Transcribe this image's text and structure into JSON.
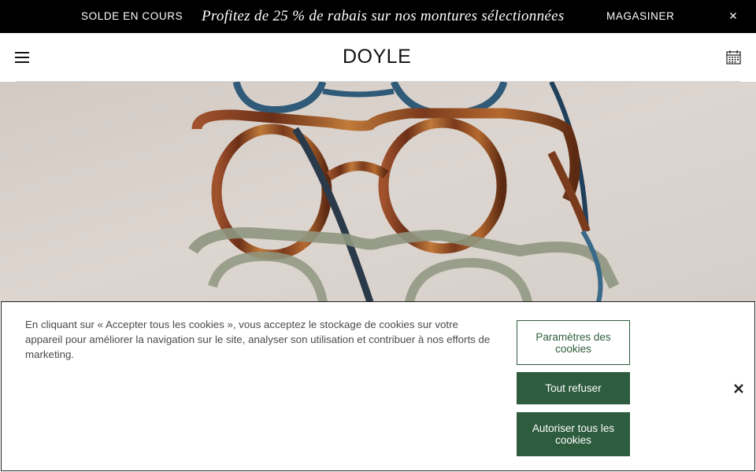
{
  "promo": {
    "sale_label": "SOLDE EN COURS",
    "message": "Profitez de 25 % de rabais sur nos montures sélectionnées",
    "shop_label": "MAGASINER",
    "close_icon": "close-icon"
  },
  "header": {
    "logo": "DOYLE",
    "menu_icon": "hamburger-menu-icon",
    "calendar_icon": "calendar-icon"
  },
  "hero": {
    "image": "stacked eyeglasses frames"
  },
  "cookie_banner": {
    "text": "En cliquant sur « Accepter tous les cookies », vous acceptez le stockage de cookies sur votre appareil pour améliorer la navigation sur le site, analyser son utilisation et contribuer à nos efforts de marketing.",
    "settings_label": "Paramètres des cookies",
    "refuse_label": "Tout refuser",
    "accept_label": "Autoriser tous les cookies",
    "close_glyph": "✕",
    "colors": {
      "button_green": "#2e5c3e",
      "border": "#222222"
    }
  }
}
